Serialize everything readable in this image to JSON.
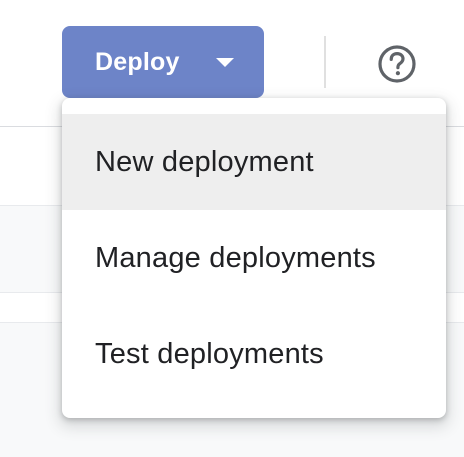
{
  "toolbar": {
    "deploy_label": "Deploy",
    "deploy_color": "#6d84c8",
    "caret_icon": "chevron-down-icon",
    "help_icon": "help-circle-icon"
  },
  "deploy_menu": {
    "items": [
      {
        "label": "New deployment",
        "highlighted": true
      },
      {
        "label": "Manage deployments",
        "highlighted": false
      },
      {
        "label": "Test deployments",
        "highlighted": false
      }
    ]
  }
}
